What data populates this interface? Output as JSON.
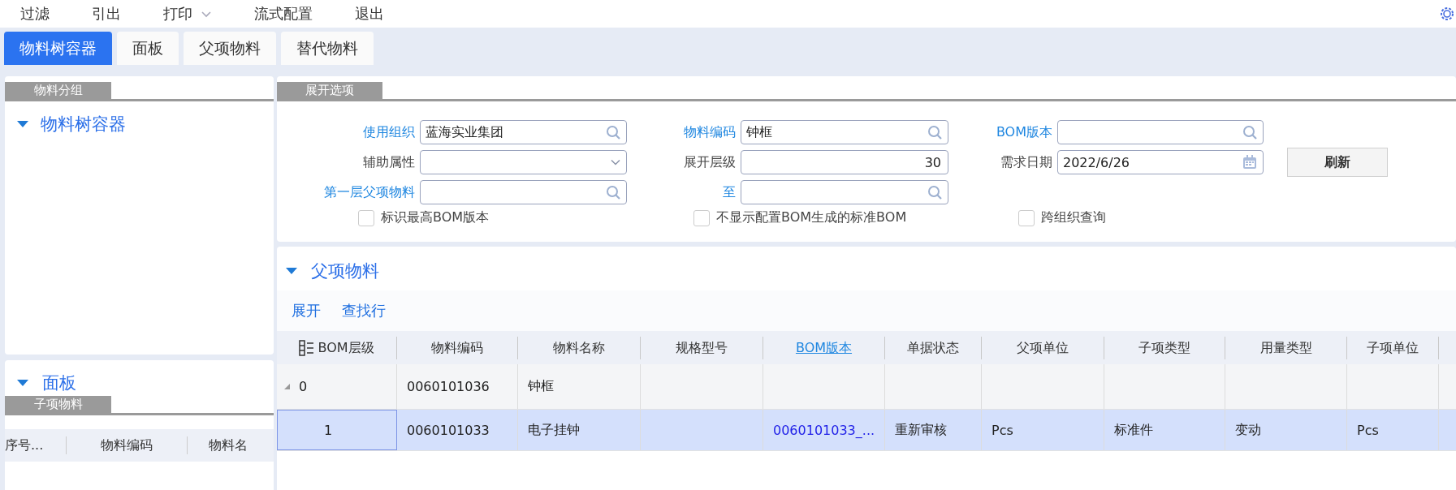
{
  "menu": [
    {
      "label": "过滤",
      "kind": "item"
    },
    {
      "label": "引出",
      "kind": "item"
    },
    {
      "label": "打印",
      "kind": "dropdown"
    },
    {
      "label": "流式配置",
      "kind": "item"
    },
    {
      "label": "退出",
      "kind": "item"
    }
  ],
  "tabs": [
    {
      "label": "物料树容器",
      "selected": true
    },
    {
      "label": "面板",
      "selected": false
    },
    {
      "label": "父项物料",
      "selected": false
    },
    {
      "label": "替代物料",
      "selected": false
    }
  ],
  "material_group": {
    "tab": "物料分组",
    "tree": [
      {
        "label": "物料树容器",
        "expanded": true
      }
    ]
  },
  "board": {
    "title": "面板",
    "expanded": true,
    "tab": "子项物料",
    "columns": [
      "序号...",
      "物料编码",
      "物料名"
    ]
  },
  "expand_options": {
    "tab": "展开选项",
    "fields": [
      {
        "label": "使用组织",
        "linked": true,
        "kind": "lookup",
        "value": "蓝海实业集团"
      },
      {
        "label": "物料编码",
        "linked": true,
        "kind": "lookup",
        "value": "钟框"
      },
      {
        "label": "BOM版本",
        "linked": true,
        "kind": "lookup"
      },
      {
        "label": "辅助属性",
        "linked": false,
        "kind": "dropdown"
      },
      {
        "label": "展开层级",
        "linked": false,
        "kind": "number",
        "value": "30"
      },
      {
        "label": "需求日期",
        "linked": false,
        "kind": "date",
        "value": "2022/6/26"
      },
      {
        "label": "第一层父项物料",
        "linked": true,
        "kind": "lookup"
      },
      {
        "label": "至",
        "linked": true,
        "kind": "lookup"
      }
    ],
    "refresh_button": "刷新",
    "checkboxes": [
      {
        "label": "标识最高BOM版本",
        "checked": false
      },
      {
        "label": "不显示配置BOM生成的标准BOM",
        "checked": false
      },
      {
        "label": "跨组织查询",
        "checked": false
      }
    ]
  },
  "parent_material": {
    "title": "父项物料",
    "expanded": true,
    "toolbar": [
      "展开",
      "查找行"
    ],
    "columns": [
      {
        "label": "BOM层级",
        "link": false
      },
      {
        "label": "物料编码",
        "link": false
      },
      {
        "label": "物料名称",
        "link": false
      },
      {
        "label": "规格型号",
        "link": false
      },
      {
        "label": "BOM版本",
        "link": true
      },
      {
        "label": "单据状态",
        "link": false
      },
      {
        "label": "父项单位",
        "link": false
      },
      {
        "label": "子项类型",
        "link": false
      },
      {
        "label": "用量类型",
        "link": false
      },
      {
        "label": "子项单位",
        "link": false
      }
    ],
    "rows": [
      {
        "cells": [
          "0",
          "0060101036",
          "钟框",
          null,
          null,
          null,
          null,
          null,
          null,
          null
        ],
        "selected": false,
        "expanded": true,
        "children": [
          {
            "cells": [
              "1",
              "0060101033",
              "电子挂钟",
              null,
              "0060101033_...",
              "重新审核",
              "Pcs",
              "标准件",
              "变动",
              "Pcs"
            ],
            "selected": true
          }
        ]
      }
    ]
  }
}
